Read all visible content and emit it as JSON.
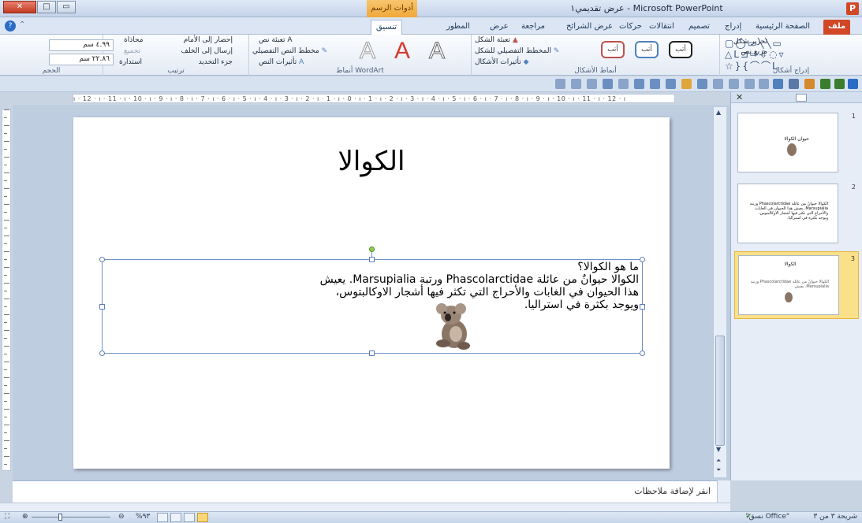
{
  "window": {
    "title": "عرض تقديمي١ - Microsoft PowerPoint",
    "contextual_tab": "أدوات الرسم",
    "app_icon": "P",
    "minimize": "▭",
    "maximize": "□",
    "close": "✕"
  },
  "ribbon_tabs": [
    "ملف",
    "الصفحة الرئيسية",
    "إدراج",
    "تصميم",
    "انتقالات",
    "حركات",
    "عرض الشرائح",
    "مراجعة",
    "عرض",
    "المطور",
    "تنسيق"
  ],
  "ribbon": {
    "insert_shapes": {
      "label": "إدراج أشكال",
      "edit_shape": "تحرير شكل",
      "text_box": "مربع نص"
    },
    "shape_styles": {
      "label": "أنماط الأشكال",
      "style_text": "أتب",
      "shape_fill": "تعبئة الشكل",
      "shape_outline": "المخطط التفصيلي للشكل",
      "shape_effects": "تأثيرات الأشكال"
    },
    "wordart": {
      "label": "أنماط WordArt",
      "letter": "A",
      "text_fill": "تعبئة نص",
      "text_outline": "مخطط النص التفصيلي",
      "text_effects": "تأثيرات النص"
    },
    "arrange": {
      "label": "ترتيب",
      "bring_forward": "إحضار إلى الأمام",
      "send_backward": "إرسال إلى الخلف",
      "selection_pane": "جزء التحديد",
      "align": "محاذاة",
      "group": "تجميع",
      "rotate": "استدارة"
    },
    "size": {
      "label": "الحجم",
      "height": "٤.٩٩ سم",
      "width": "٢٢.٨٦ سم"
    }
  },
  "ruler_text": "ı · 12 · ı · 11 · ı · 10 · ı · 9 · ı · 8 · ı · 7 · ı · 6 · ı · 5 · ı · 4 · ı · 3 · ı · 2 · ı · 1 · ı · 0 · ı · 1 · ı · 2 · ı · 3 · ı · 4 · ı · 5 · ı · 6 · ı · 7 · ı · 8 · ı · 9 · ı · 10 · ı · 11 · ı · 12 · ı",
  "slide": {
    "title": "الكوالا",
    "body_lines": [
      "ما هو الكوالا؟",
      "الكوالا حيوانٌ من عائلة Phascolarctidae ورتبة Marsupialia. يعيش",
      "هذا الحيوان في الغابات والأحراج التي تكثر فيها أشجار الاوكالبتوس،",
      "ويوجد بكثرة في استراليا."
    ]
  },
  "slides_pane": {
    "thumbnails": [
      {
        "number": "1",
        "title": "حيوان الكوالا"
      },
      {
        "number": "2",
        "text": "الكوالا حيوانٌ من عائلة Phascolarctidae ورتبة Marsupialia. يعيش هذا الحيوان في الغابات والأحراج التي تكثر فيها أشجار الاوكالبتوس، ويوجد بكثرة في استراليا."
      },
      {
        "number": "3",
        "title": "الكوالا"
      }
    ]
  },
  "notes": {
    "placeholder": "انقر لإضافة ملاحظات"
  },
  "status": {
    "slide_info": "شريحة ٣ من ٣",
    "theme": "\"نسق Office\"",
    "zoom": "%٩٣"
  },
  "colors": {
    "file_tab": "#d24726",
    "contextual": "#f0a83a",
    "selected_thumb": "#fbe08a"
  }
}
